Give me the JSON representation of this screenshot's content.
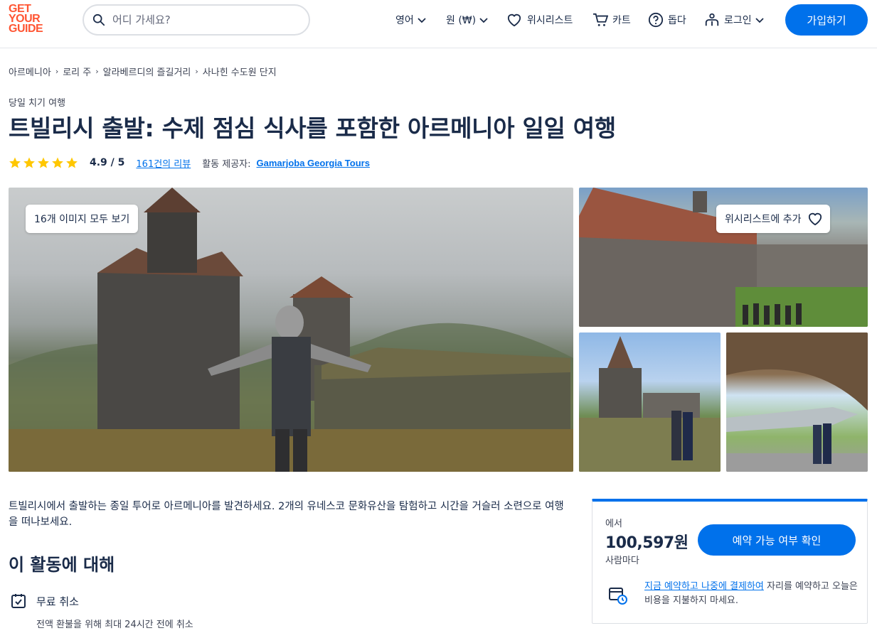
{
  "brand": {
    "logo_lines": [
      "GET",
      "YOUR",
      "GUIDE"
    ],
    "accent": "#ff5533",
    "primary": "#0071eb"
  },
  "header": {
    "search_placeholder": "어디 가세요?",
    "language": "영어",
    "currency": "원 (₩)",
    "wishlist": "위시리스트",
    "cart": "카트",
    "help": "돕다",
    "login": "로그인",
    "signup": "가입하기"
  },
  "breadcrumb": [
    "아르메니아",
    "로리 주",
    "알라베르디의 즐길거리",
    "사나힌 수도원 단지"
  ],
  "activity": {
    "category": "당일 치기 여행",
    "title": "트빌리시 출발: 수제 점심 식사를 포함한 아르메니아 일일 여행",
    "rating_value": "4.9 / 5",
    "stars": 5,
    "reviews_link": "161건의 리뷰",
    "provider_label": "활동 제공자:",
    "provider_name": "Gamarjoba Georgia Tours"
  },
  "gallery": {
    "view_all": "16개 이미지 모두 보기",
    "add_wishlist": "위시리스트에 추가"
  },
  "description": {
    "intro": "트빌리시에서 출발하는 종일 투어로 아르메니아를 발견하세요. 2개의 유네스코 문화유산을 탐험하고 시간을 거슬러 소련으로 여행을 떠나보세요.",
    "about_title": "이 활동에 대해",
    "feature_title": "무료 취소",
    "feature_desc": "전액 환불을 위해 최대 24시간 전에 취소"
  },
  "booking": {
    "from_label": "에서",
    "price": "100,597원",
    "per_person": "사람마다",
    "check_button": "예약 가능 여부 확인",
    "reserve_link": "지금 예약하고 나중에 결제하여",
    "reserve_text": " 자리를 예약하고 오늘은 비용을 지불하지 마세요."
  }
}
